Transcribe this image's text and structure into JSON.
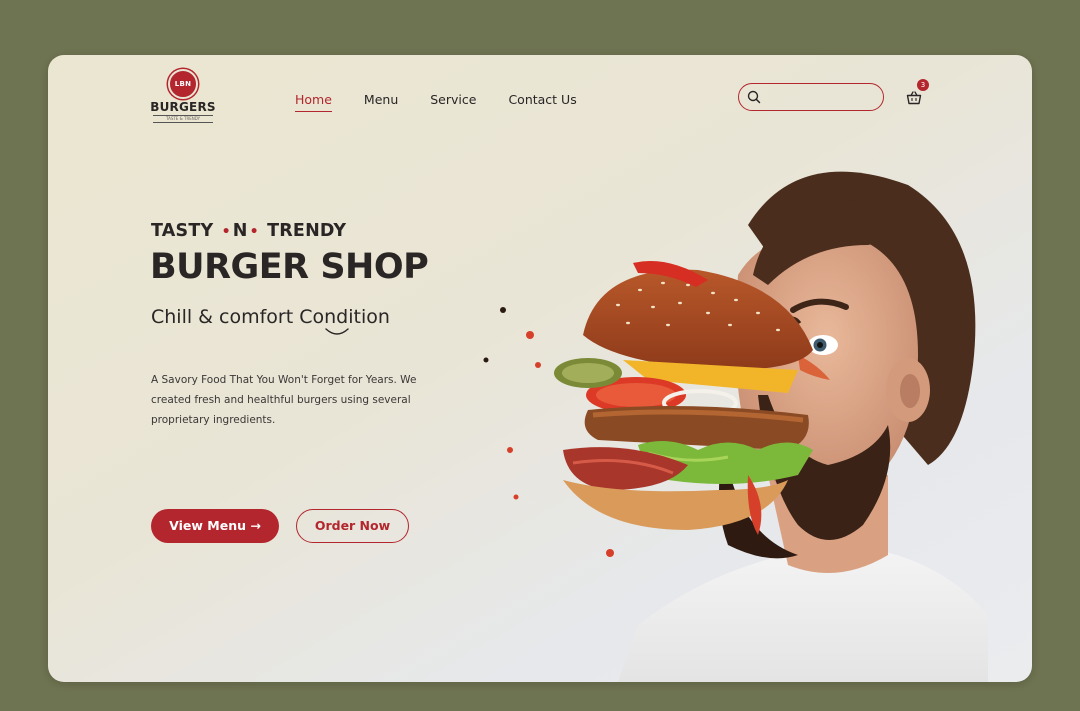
{
  "header": {
    "logo": {
      "badge_text": "LBN",
      "brand": "BURGERS",
      "tagline": "TASTE & TRENDY"
    },
    "nav": [
      {
        "label": "Home",
        "active": true
      },
      {
        "label": "Menu",
        "active": false
      },
      {
        "label": "Service",
        "active": false
      },
      {
        "label": "Contact Us",
        "active": false
      }
    ],
    "search": {
      "value": "",
      "placeholder": ""
    },
    "cart": {
      "icon": "basket-icon",
      "count": "3"
    }
  },
  "hero": {
    "eyebrow": {
      "part1": "TASTY",
      "part2": "N",
      "part3": "TRENDY"
    },
    "title": "BURGER SHOP",
    "subtitle": "Chill & comfort Condition",
    "description": "A Savory Food That You Won't Forget for Years. We created fresh and healthful burgers using several proprietary ingredients.",
    "primary_button": "View Menu →",
    "secondary_button": "Order Now",
    "image": "man-eating-burger-photo"
  },
  "colors": {
    "accent": "#b3262d",
    "text": "#2a2626",
    "backdrop": "#6e7351",
    "card": "#ebe6d6"
  }
}
